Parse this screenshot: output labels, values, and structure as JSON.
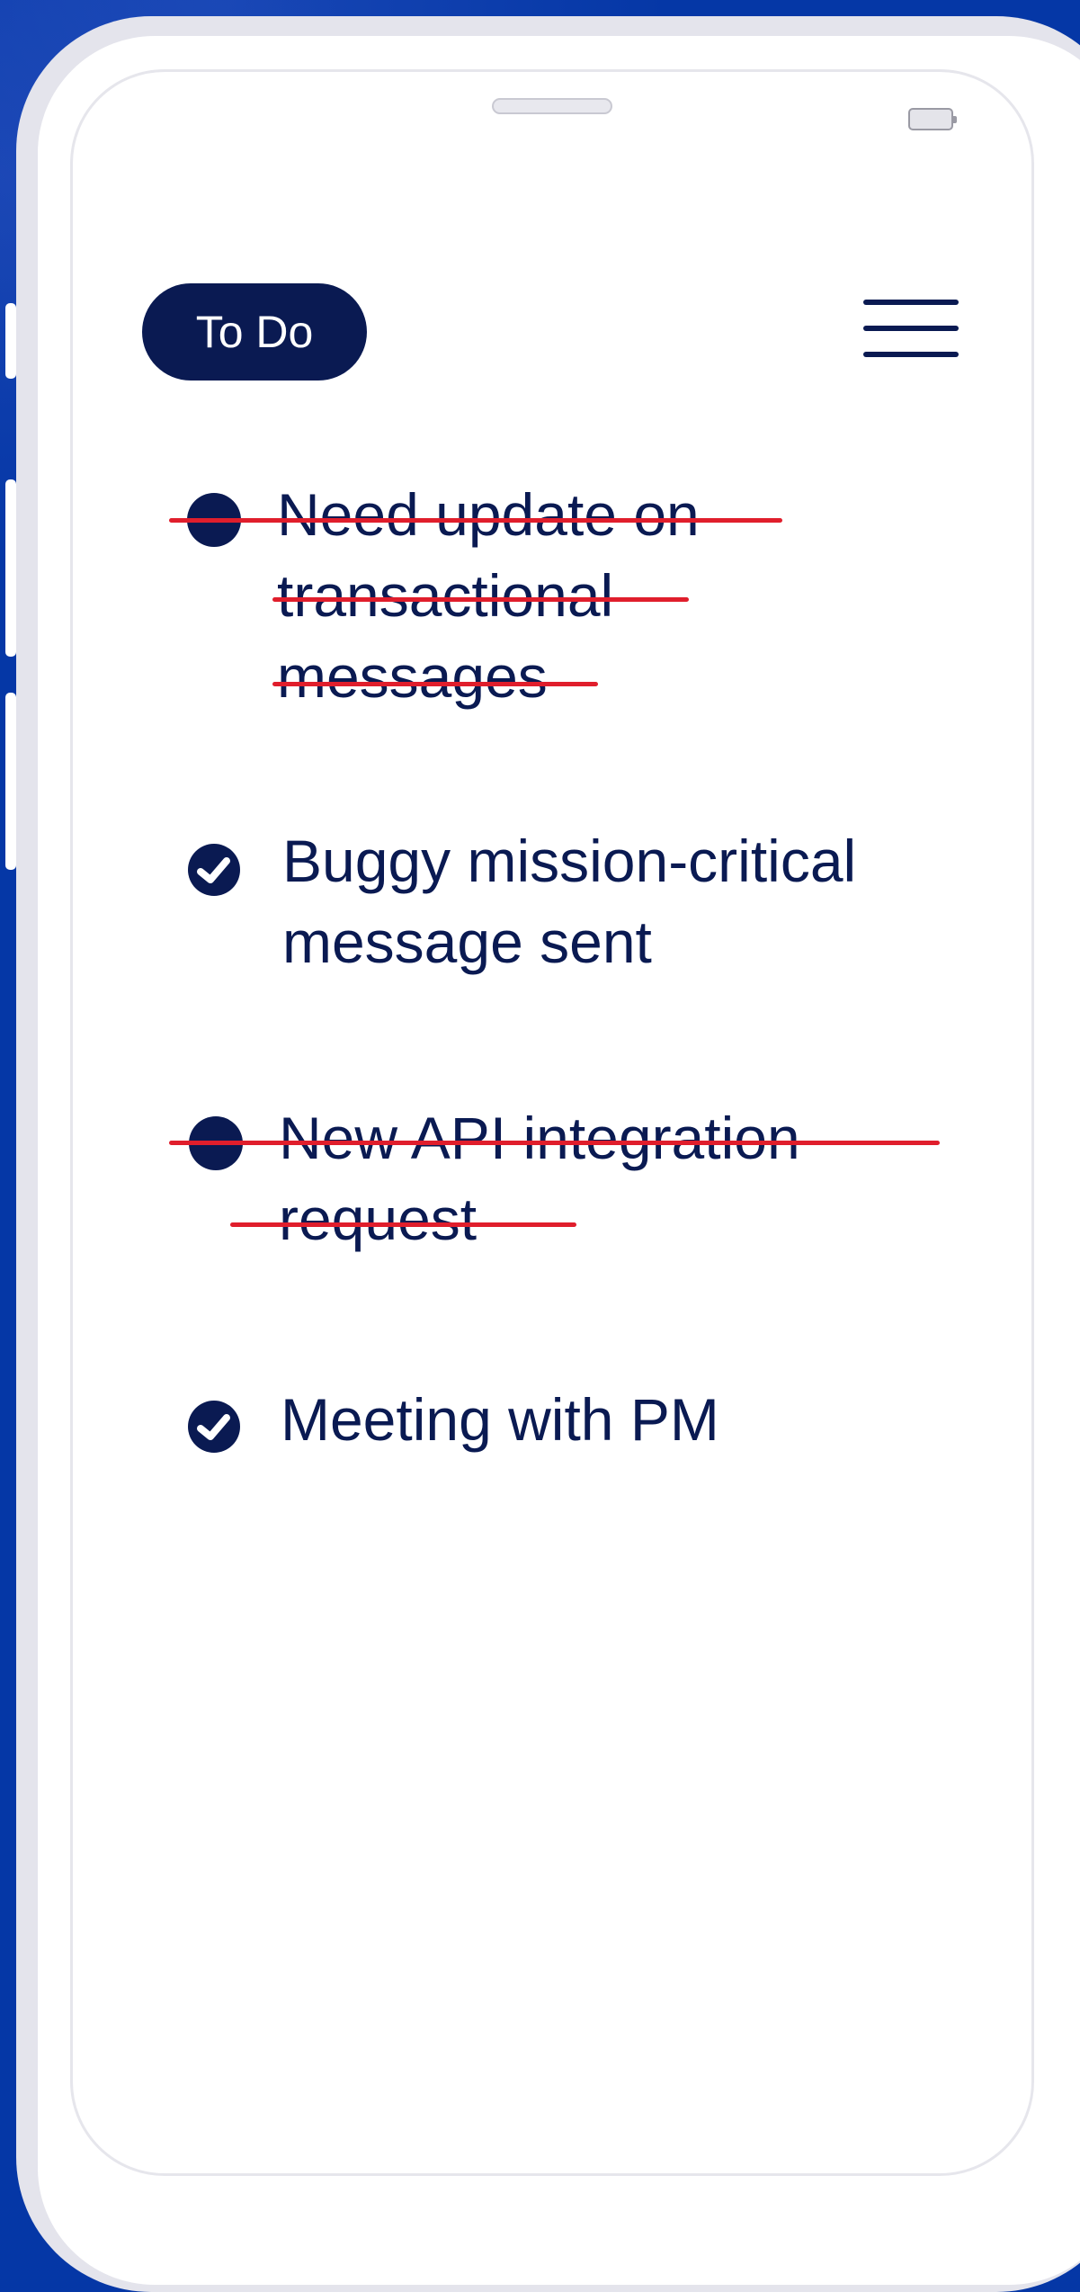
{
  "app": {
    "title": "To Do"
  },
  "header": {
    "badge_label": "To Do",
    "menu_icon": "hamburger-menu-icon"
  },
  "tasks": [
    {
      "lines": [
        "Need update on",
        "transactional",
        "messages"
      ],
      "completed": true,
      "marker": "filled-dot"
    },
    {
      "lines": [
        "Buggy mission-critical",
        "message sent"
      ],
      "completed": false,
      "marker": "check-icon"
    },
    {
      "lines": [
        "New API integration",
        "request"
      ],
      "completed": true,
      "marker": "filled-dot"
    },
    {
      "lines": [
        "Meeting with PM"
      ],
      "completed": false,
      "marker": "check-icon"
    }
  ],
  "colors": {
    "background": "#0537a6",
    "primary": "#0a1a52",
    "strike": "#e01e2c",
    "screen": "#ffffff",
    "frame": "#e4e4ec"
  }
}
